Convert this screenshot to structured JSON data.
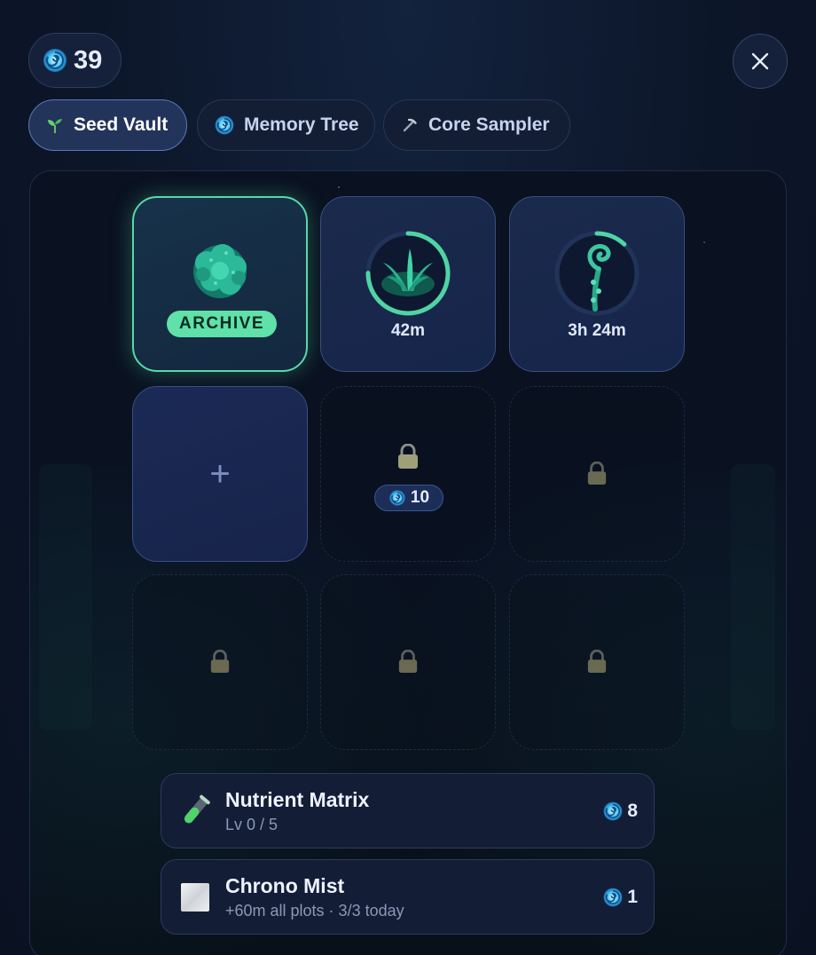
{
  "currency": {
    "amount": "39",
    "icon": "spiral-gem-icon",
    "color": "#3fb8e8"
  },
  "tabs": [
    {
      "label": "Seed Vault",
      "icon": "sprout-icon",
      "active": true
    },
    {
      "label": "Memory Tree",
      "icon": "spiral-gem-icon",
      "active": false
    },
    {
      "label": "Core Sampler",
      "icon": "pickaxe-icon",
      "active": false
    }
  ],
  "plots": [
    {
      "state": "ready",
      "badge": "ARCHIVE",
      "plant": "teal-coral-plant"
    },
    {
      "state": "growing",
      "timer": "42m",
      "plant": "teal-fern-bush",
      "progress": 0.75
    },
    {
      "state": "growing",
      "timer": "3h 24m",
      "plant": "spiral-fern-sprout",
      "progress": 0.12
    },
    {
      "state": "empty",
      "label": "+"
    },
    {
      "state": "locked",
      "price": "10"
    },
    {
      "state": "locked"
    },
    {
      "state": "locked"
    },
    {
      "state": "locked"
    },
    {
      "state": "locked"
    }
  ],
  "upgrades": [
    {
      "title": "Nutrient Matrix",
      "subtitle": "Lv 0 / 5",
      "cost": "8",
      "icon": "test-tube-icon"
    },
    {
      "title": "Chrono Mist",
      "subtitle": "+60m all plots · 3/3 today",
      "cost": "1",
      "icon": "mist-square-icon"
    }
  ],
  "colors": {
    "accent_ready": "#5fe1a9",
    "active_tab": "#22345a",
    "progress_ring": "#4fd4a4"
  }
}
